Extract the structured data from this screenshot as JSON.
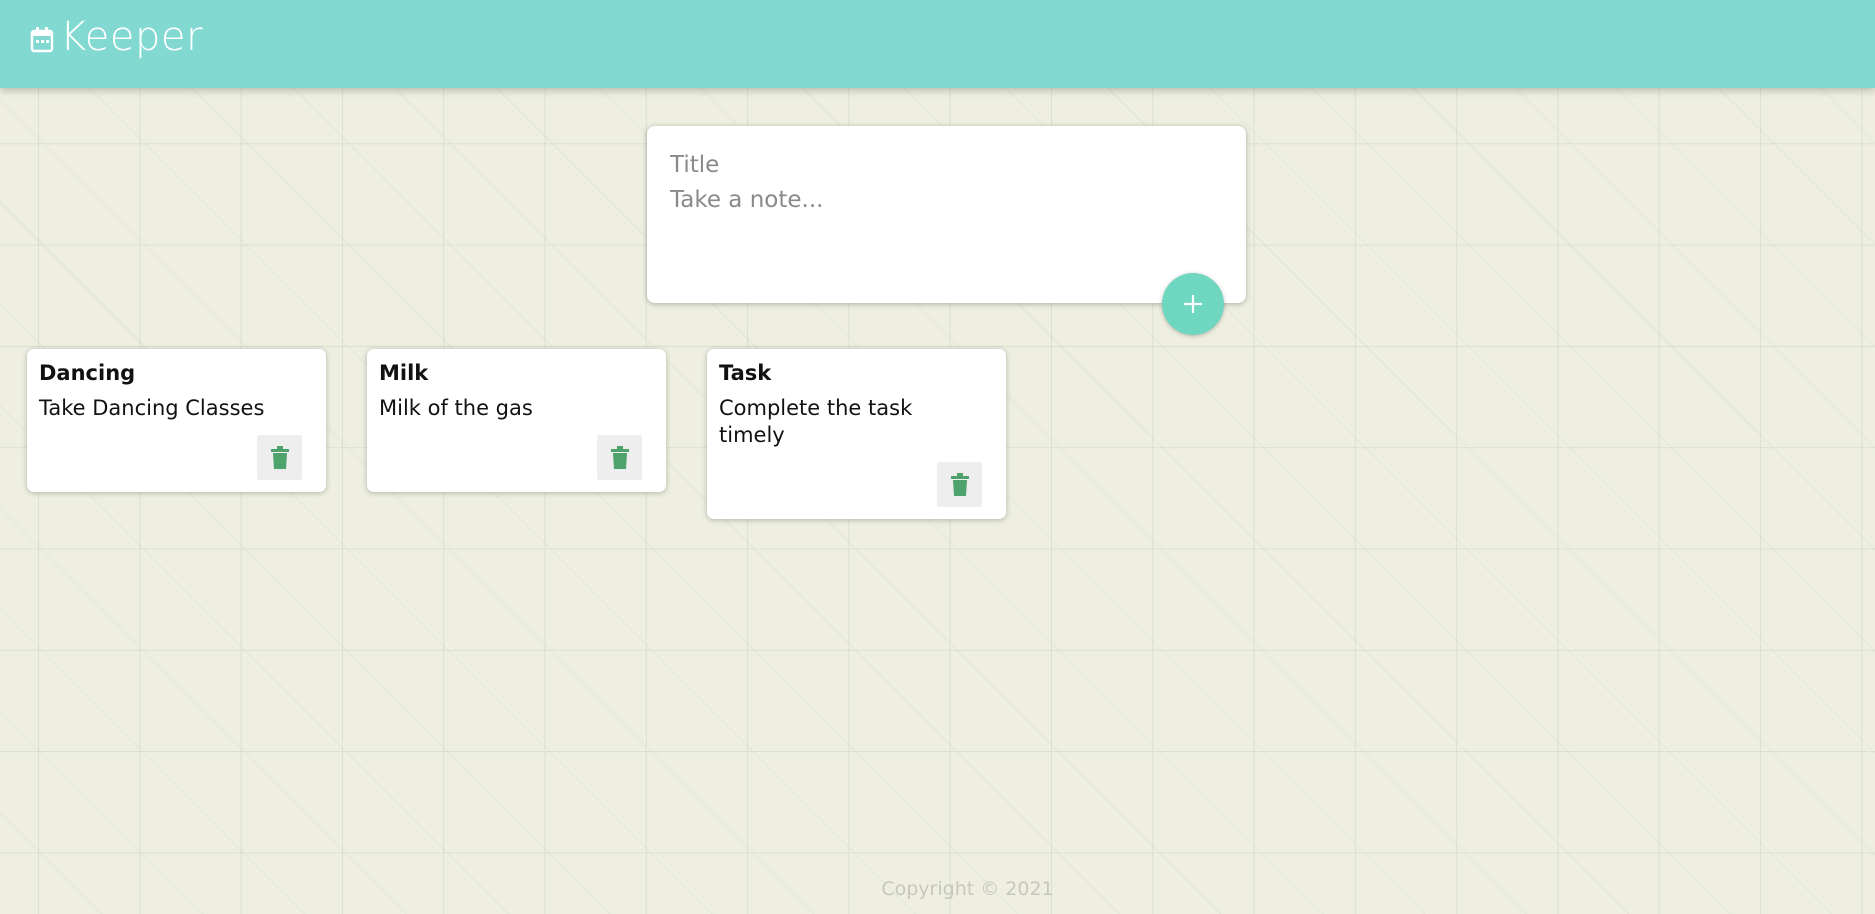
{
  "app": {
    "title": "Keeper",
    "accent": "#82d9d2"
  },
  "composer": {
    "title_placeholder": "Title",
    "content_placeholder": "Take a note...",
    "add_icon": "plus-icon",
    "add_color": "#6fd6c0"
  },
  "notes": [
    {
      "title": "Dancing",
      "content": "Take Dancing Classes",
      "delete_icon": "trash-icon"
    },
    {
      "title": "Milk",
      "content": "Milk of the gas",
      "delete_icon": "trash-icon"
    },
    {
      "title": "Task",
      "content": "Complete the task timely",
      "delete_icon": "trash-icon"
    }
  ],
  "footer": {
    "text": "Copyright © 2021"
  },
  "colors": {
    "background": "#eeefe0",
    "trash": "#4ea26b"
  }
}
